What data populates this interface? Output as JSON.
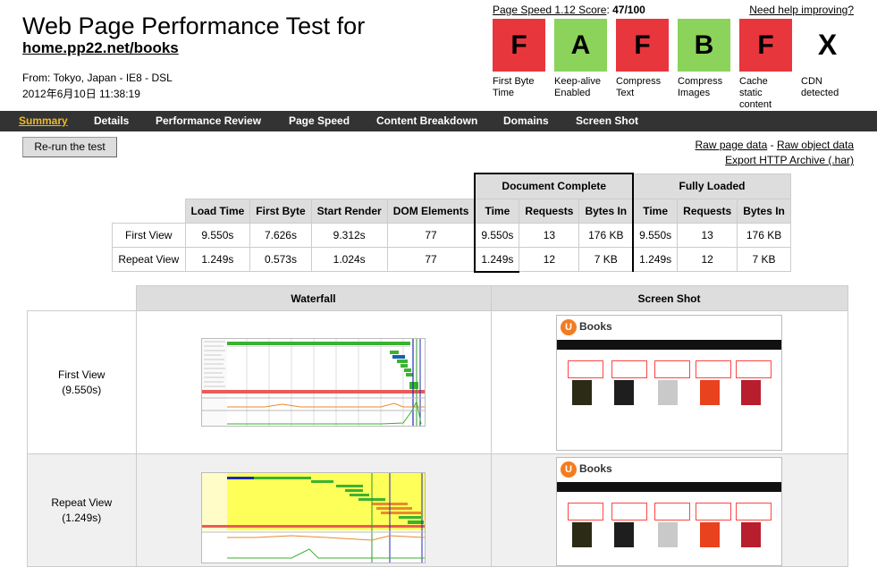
{
  "header": {
    "title": "Web Page Performance Test for",
    "url": "home.pp22.net/books",
    "from": "From: Tokyo, Japan - IE8 - DSL",
    "date": "2012年6月10日 11:38:19",
    "score_label": "Page Speed 1.12 Score",
    "score_value": "47/100",
    "help_link": "Need help improving?"
  },
  "grades": [
    {
      "letter": "F",
      "label": "First Byte Time",
      "color": "#e8363d"
    },
    {
      "letter": "A",
      "label": "Keep-alive Enabled",
      "color": "#8bd35a"
    },
    {
      "letter": "F",
      "label": "Compress Text",
      "color": "#e8363d"
    },
    {
      "letter": "B",
      "label": "Compress Images",
      "color": "#8bd35a"
    },
    {
      "letter": "F",
      "label": "Cache static content",
      "color": "#e8363d"
    },
    {
      "letter": "X",
      "label": "CDN detected",
      "color": "#ffffff"
    }
  ],
  "nav": {
    "summary": "Summary",
    "details": "Details",
    "performance_review": "Performance Review",
    "page_speed": "Page Speed",
    "content_breakdown": "Content Breakdown",
    "domains": "Domains",
    "screen_shot": "Screen Shot"
  },
  "actions": {
    "rerun": "Re-run the test",
    "raw_page": "Raw page data",
    "separator": "-",
    "raw_object": "Raw object data",
    "export_har": "Export HTTP Archive (.har)"
  },
  "results": {
    "group_document": "Document Complete",
    "group_fully": "Fully Loaded",
    "columns": [
      "Load Time",
      "First Byte",
      "Start Render",
      "DOM Elements",
      "Time",
      "Requests",
      "Bytes In",
      "Time",
      "Requests",
      "Bytes In"
    ],
    "rows": [
      {
        "label": "First View",
        "cells": [
          "9.550s",
          "7.626s",
          "9.312s",
          "77",
          "9.550s",
          "13",
          "176 KB",
          "9.550s",
          "13",
          "176 KB"
        ]
      },
      {
        "label": "Repeat View",
        "cells": [
          "1.249s",
          "0.573s",
          "1.024s",
          "77",
          "1.249s",
          "12",
          "7 KB",
          "1.249s",
          "12",
          "7 KB"
        ]
      }
    ]
  },
  "visuals": {
    "waterfall_header": "Waterfall",
    "screenshot_header": "Screen Shot",
    "first_view_label": "First View",
    "first_view_time": "(9.550s)",
    "repeat_view_label": "Repeat View",
    "repeat_view_time": "(1.249s)",
    "site_brand": "Books",
    "site_logo_letter": "U"
  },
  "colors": {
    "nav_bg": "#333333",
    "nav_active": "#f0b929",
    "grade_fail": "#e8363d",
    "grade_pass": "#8bd35a"
  }
}
